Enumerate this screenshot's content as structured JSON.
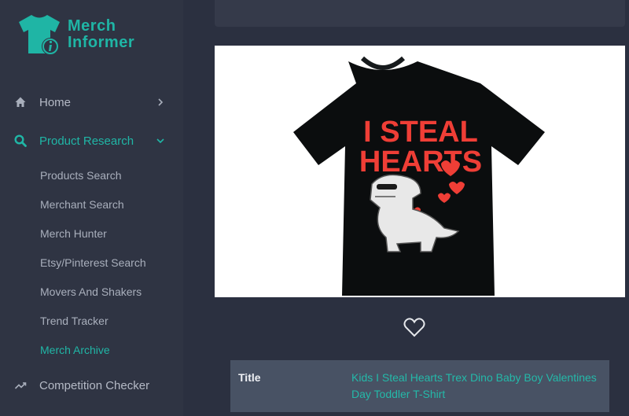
{
  "brand": {
    "line1": "Merch",
    "line2": "Informer",
    "color": "#1fb5a5"
  },
  "nav": {
    "home": {
      "label": "Home",
      "icon": "home-icon"
    },
    "product_research": {
      "label": "Product Research",
      "icon": "search-icon",
      "expanded": true,
      "items": [
        {
          "label": "Products Search",
          "active": false
        },
        {
          "label": "Merchant Search",
          "active": false
        },
        {
          "label": "Merch Hunter",
          "active": false
        },
        {
          "label": "Etsy/Pinterest Search",
          "active": false
        },
        {
          "label": "Movers And Shakers",
          "active": false
        },
        {
          "label": "Trend Tracker",
          "active": false
        },
        {
          "label": "Merch Archive",
          "active": true
        }
      ]
    },
    "competition_checker": {
      "label": "Competition Checker",
      "icon": "trending-up-icon"
    }
  },
  "product": {
    "shirt_text_line1": "I STEAL",
    "shirt_text_line2": "HEARTS",
    "favorite_icon": "heart-outline-icon",
    "details": [
      {
        "key": "Title",
        "value": "Kids I Steal Hearts Trex Dino Baby Boy Valentines Day Toddler T-Shirt"
      }
    ]
  },
  "colors": {
    "accent": "#20b6a6",
    "sidebar": "#2f3443",
    "background": "#2b3040",
    "shirt_print": "#ef3e36"
  }
}
